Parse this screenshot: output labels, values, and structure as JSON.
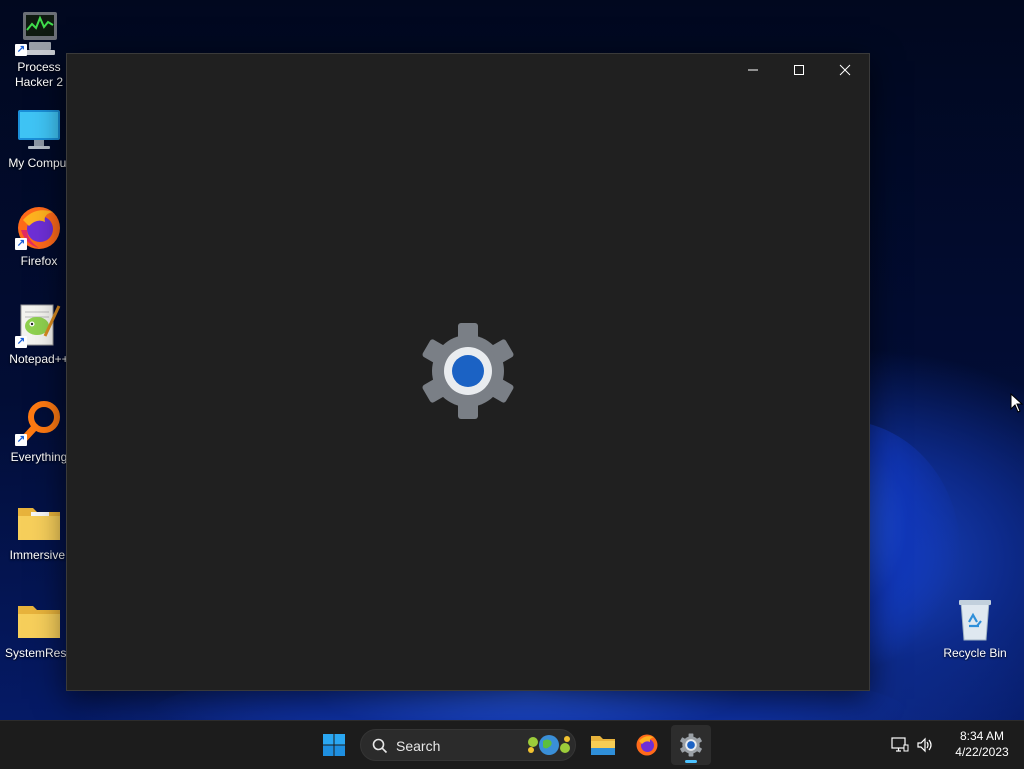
{
  "desktop": {
    "icons": [
      {
        "label": "Process\nHacker 2",
        "icon": "process-hacker-icon"
      },
      {
        "label": "My Comput",
        "icon": "monitor-icon"
      },
      {
        "label": "Firefox",
        "icon": "firefox-icon"
      },
      {
        "label": "Notepad++",
        "icon": "notepad-plus-plus-icon"
      },
      {
        "label": "Everything",
        "icon": "everything-search-icon"
      },
      {
        "label": "Immersive.",
        "icon": "folder-icon"
      },
      {
        "label": "SystemReso",
        "icon": "folder-icon"
      }
    ],
    "recycle_bin": {
      "label": "Recycle Bin",
      "icon": "recycle-bin-icon"
    }
  },
  "window": {
    "title": "",
    "controls": {
      "minimize": "minimize-icon",
      "maximize": "maximize-icon",
      "close": "close-icon"
    },
    "splash_icon": "settings-gear-icon",
    "accent": "#1b62c4"
  },
  "taskbar": {
    "search": {
      "placeholder": "Search"
    },
    "apps": [
      "start-icon",
      "file-explorer-icon",
      "firefox-icon",
      "settings-icon"
    ],
    "active_app": "settings-icon",
    "tray": {
      "network": "network-icon",
      "volume": "volume-icon"
    },
    "clock": {
      "time": "8:34 AM",
      "date": "4/22/2023"
    }
  }
}
